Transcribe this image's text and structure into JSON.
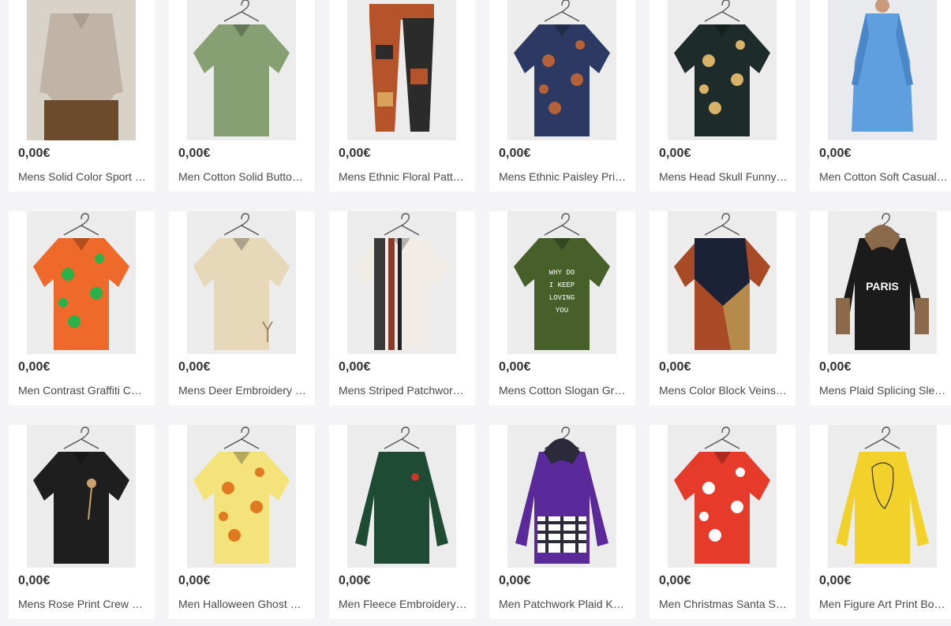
{
  "products": [
    {
      "price": "0,00€",
      "title": "Mens Solid Color Sport Casual Golf Shirt",
      "image": "solid-polo-shirt",
      "color": "#bfb4a6",
      "accent": "#6b4a2e"
    },
    {
      "price": "0,00€",
      "title": "Men Cotton Solid Button Henley Shirt",
      "image": "green-henley-shirt",
      "color": "#86a074",
      "accent": "#6c8760"
    },
    {
      "price": "0,00€",
      "title": "Mens Ethnic Floral Pattern Pants",
      "image": "ethnic-pattern-pants",
      "color": "#b5532a",
      "accent": "#2b2b2b"
    },
    {
      "price": "0,00€",
      "title": "Mens Ethnic Paisley Print Shirt",
      "image": "paisley-shirt",
      "color": "#2c3a63",
      "accent": "#b5623a"
    },
    {
      "price": "0,00€",
      "title": "Mens Head Skull Funny Shirt",
      "image": "skull-print-shirt",
      "color": "#1d2c2a",
      "accent": "#d9b26a"
    },
    {
      "price": "0,00€",
      "title": "Men Cotton Soft Casual Robe",
      "image": "blue-robe",
      "color": "#5f9fe0",
      "accent": "#4a86c8"
    },
    {
      "price": "0,00€",
      "title": "Men Contrast Graffiti Color Shirt",
      "image": "graffiti-shirt",
      "color": "#ef6a2a",
      "accent": "#29b24a"
    },
    {
      "price": "0,00€",
      "title": "Mens Deer Embroidery Henley Shirt",
      "image": "beige-deer-shirt",
      "color": "#e6d8b8",
      "accent": "#8a7250"
    },
    {
      "price": "0,00€",
      "title": "Mens Striped Patchwork T-Shirt",
      "image": "striped-patchwork-tee",
      "color": "#f1ede6",
      "accent": "#222222"
    },
    {
      "price": "0,00€",
      "title": "Mens Cotton Slogan Graphic T-Shirt",
      "image": "slogan-tee",
      "color": "#47602a",
      "accent": "#ffffff"
    },
    {
      "price": "0,00€",
      "title": "Mens Color Block Veins T-Shirt",
      "image": "color-block-tee",
      "color": "#a84a25",
      "accent": "#1c2236"
    },
    {
      "price": "0,00€",
      "title": "Mens Plaid Splicing Sleeve Hoodie",
      "image": "paris-hoodie",
      "color": "#1b1b1b",
      "accent": "#8a6a4a"
    },
    {
      "price": "0,00€",
      "title": "Mens Rose Print Crew Neck T-Shirt",
      "image": "rose-print-tee",
      "color": "#1e1e1e",
      "accent": "#c9a36a"
    },
    {
      "price": "0,00€",
      "title": "Men Halloween Ghost Print Shirt",
      "image": "halloween-shirt",
      "color": "#f4e27a",
      "accent": "#e07a20"
    },
    {
      "price": "0,00€",
      "title": "Men Fleece Embroidery Sweatshirt",
      "image": "green-fleece-sweatshirt",
      "color": "#1f4a33",
      "accent": "#c0392b"
    },
    {
      "price": "0,00€",
      "title": "Men Patchwork Plaid Kangaroo Hoodie",
      "image": "purple-hoodie",
      "color": "#5a2a9a",
      "accent": "#2a2a3a"
    },
    {
      "price": "0,00€",
      "title": "Men Christmas Santa Snowflake Shirt",
      "image": "santa-shirt",
      "color": "#e63a2a",
      "accent": "#ffffff"
    },
    {
      "price": "0,00€",
      "title": "Men Figure Art Print Bodysuit",
      "image": "yellow-sweatshirt",
      "color": "#f2d22a",
      "accent": "#333333"
    }
  ]
}
